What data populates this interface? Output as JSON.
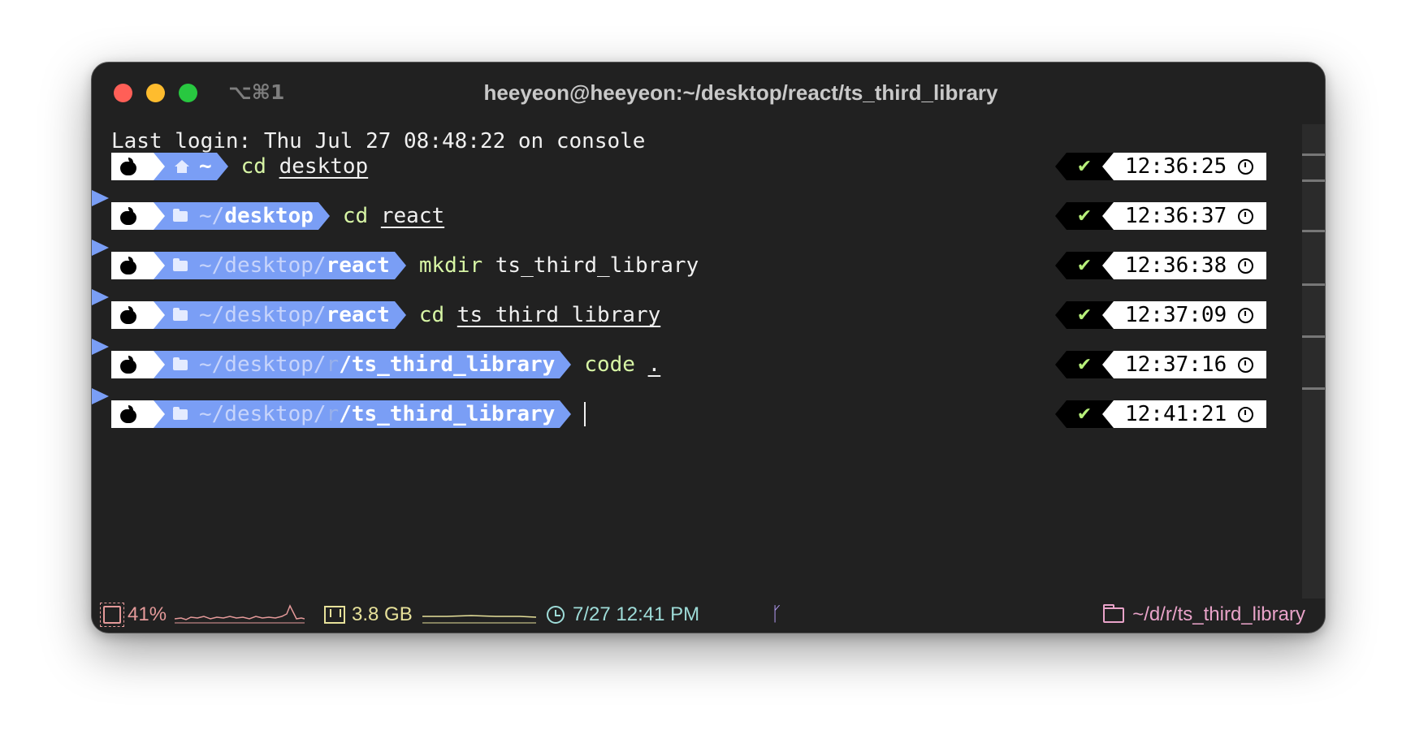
{
  "window": {
    "title": "heeyeon@heeyeon:~/desktop/react/ts_third_library",
    "shortcut": "⌥⌘1"
  },
  "terminal": {
    "last_login": "Last login: Thu Jul 27 08:48:22 on console",
    "prompts": [
      {
        "icon": "home-icon",
        "path_prefix": "",
        "path_dim": "",
        "path_bold": "~",
        "command": "cd",
        "argument": "desktop",
        "argument_underlined": true,
        "time": "12:36:25"
      },
      {
        "icon": "folder-icon",
        "path_prefix": "~/",
        "path_dim": "",
        "path_bold": "desktop",
        "command": "cd",
        "argument": "react",
        "argument_underlined": true,
        "time": "12:36:37"
      },
      {
        "icon": "folder-icon",
        "path_prefix": "~/desktop/",
        "path_dim": "",
        "path_bold": "react",
        "command": "mkdir",
        "argument": "ts_third_library",
        "argument_underlined": false,
        "time": "12:36:38"
      },
      {
        "icon": "folder-icon",
        "path_prefix": "~/desktop/",
        "path_dim": "",
        "path_bold": "react",
        "command": "cd",
        "argument": "ts_third_library",
        "argument_underlined": true,
        "time": "12:37:09"
      },
      {
        "icon": "folder-icon",
        "path_prefix": "~/desktop/",
        "path_dim": "r",
        "path_bold": "/ts_third_library",
        "command": "code",
        "argument": ".",
        "argument_underlined": true,
        "time": "12:37:16"
      },
      {
        "icon": "folder-icon",
        "path_prefix": "~/desktop/",
        "path_dim": "r",
        "path_bold": "/ts_third_library",
        "command": "",
        "argument": "",
        "argument_underlined": false,
        "time": "12:41:21"
      }
    ],
    "success_mark": "✔",
    "colors": {
      "prompt_blue": "#7a9ef5",
      "command_green": "#d7f5a5",
      "check_green": "#b7f07a"
    }
  },
  "status_bar": {
    "cpu": "41%",
    "memory": "3.8 GB",
    "datetime": "7/27 12:41 PM",
    "path": "~/d/r/ts_third_library",
    "colors": {
      "cpu": "#e59a9a",
      "memory": "#e7e19a",
      "clock": "#9edcd8",
      "git": "#b49cf5",
      "path": "#e9a3c9"
    }
  }
}
